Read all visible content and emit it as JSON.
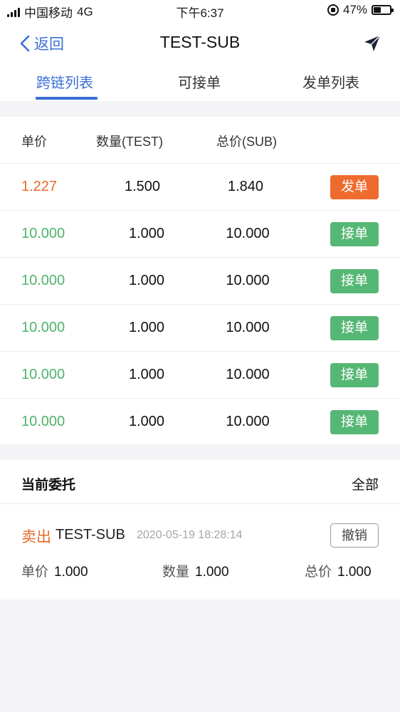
{
  "status_bar": {
    "carrier": "中国移动",
    "network": "4G",
    "time": "下午6:37",
    "battery": "47%",
    "battery_level": 0.47
  },
  "nav": {
    "back_label": "返回",
    "title": "TEST-SUB"
  },
  "tabs": [
    {
      "label": "跨链列表",
      "active": true
    },
    {
      "label": "可接单",
      "active": false
    },
    {
      "label": "发单列表",
      "active": false
    }
  ],
  "table": {
    "headers": [
      "单价",
      "数量(TEST)",
      "总价(SUB)"
    ],
    "rows": [
      {
        "price": "1.227",
        "qty": "1.500",
        "total": "1.840",
        "action": "发单",
        "type": "sell"
      },
      {
        "price": "10.000",
        "qty": "1.000",
        "total": "10.000",
        "action": "接单",
        "type": "buy"
      },
      {
        "price": "10.000",
        "qty": "1.000",
        "total": "10.000",
        "action": "接单",
        "type": "buy"
      },
      {
        "price": "10.000",
        "qty": "1.000",
        "total": "10.000",
        "action": "接单",
        "type": "buy"
      },
      {
        "price": "10.000",
        "qty": "1.000",
        "total": "10.000",
        "action": "接单",
        "type": "buy"
      },
      {
        "price": "10.000",
        "qty": "1.000",
        "total": "10.000",
        "action": "接单",
        "type": "buy"
      }
    ]
  },
  "orders": {
    "title": "当前委托",
    "all_label": "全部",
    "items": [
      {
        "side": "卖出",
        "pair": "TEST-SUB",
        "time": "2020-05-19 18:28:14",
        "cancel_label": "撤销",
        "price_label": "单价",
        "price": "1.000",
        "qty_label": "数量",
        "qty": "1.000",
        "total_label": "总价",
        "total": "1.000"
      }
    ]
  },
  "colors": {
    "accent": "#3a6fd8",
    "sell": "#e8692d",
    "buy": "#4fb36c",
    "sell_button": "#ee6b2f",
    "buy_button": "#55b774"
  },
  "icons": {
    "back": "chevron-left-icon",
    "send": "send-icon",
    "lock": "orientation-lock-icon",
    "battery": "battery-charging-icon"
  }
}
